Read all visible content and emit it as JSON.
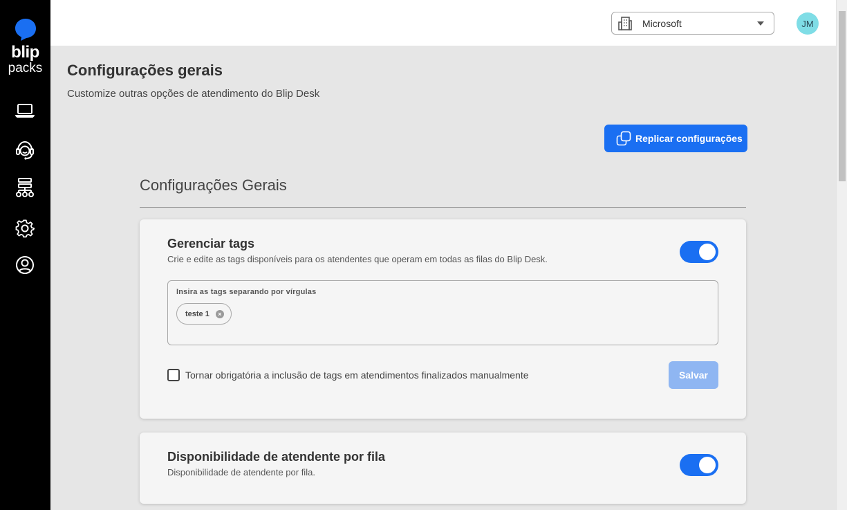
{
  "brand": {
    "name_line1": "blip",
    "name_line2": "packs",
    "accent": "#1a6ff2"
  },
  "sidebar": {
    "items": [
      {
        "icon": "laptop-icon"
      },
      {
        "icon": "support-agent-icon"
      },
      {
        "icon": "sitemap-icon"
      },
      {
        "icon": "gear-icon"
      },
      {
        "icon": "user-profile-icon"
      }
    ]
  },
  "header": {
    "tenant": {
      "icon": "building-icon",
      "selected": "Microsoft"
    },
    "avatar_initials": "JM"
  },
  "page": {
    "title": "Configurações gerais",
    "subtitle": "Customize outras opções de atendimento do Blip Desk",
    "replicate_button": "Replicar configurações",
    "section_title": "Configurações Gerais"
  },
  "cards": {
    "tags": {
      "title": "Gerenciar tags",
      "description": "Crie e edite as tags disponíveis para os atendentes que operam em todas as filas do Blip Desk.",
      "enabled": true,
      "input_label": "Insira as tags separando por vírgulas",
      "chips": [
        "teste 1"
      ],
      "required_checkbox_label": "Tornar obrigatória a inclusão de tags em atendimentos finalizados manualmente",
      "required_checked": false,
      "save_label": "Salvar"
    },
    "availability": {
      "title": "Disponibilidade de atendente por fila",
      "description": "Disponibilidade de atendente por fila.",
      "enabled": true
    }
  }
}
